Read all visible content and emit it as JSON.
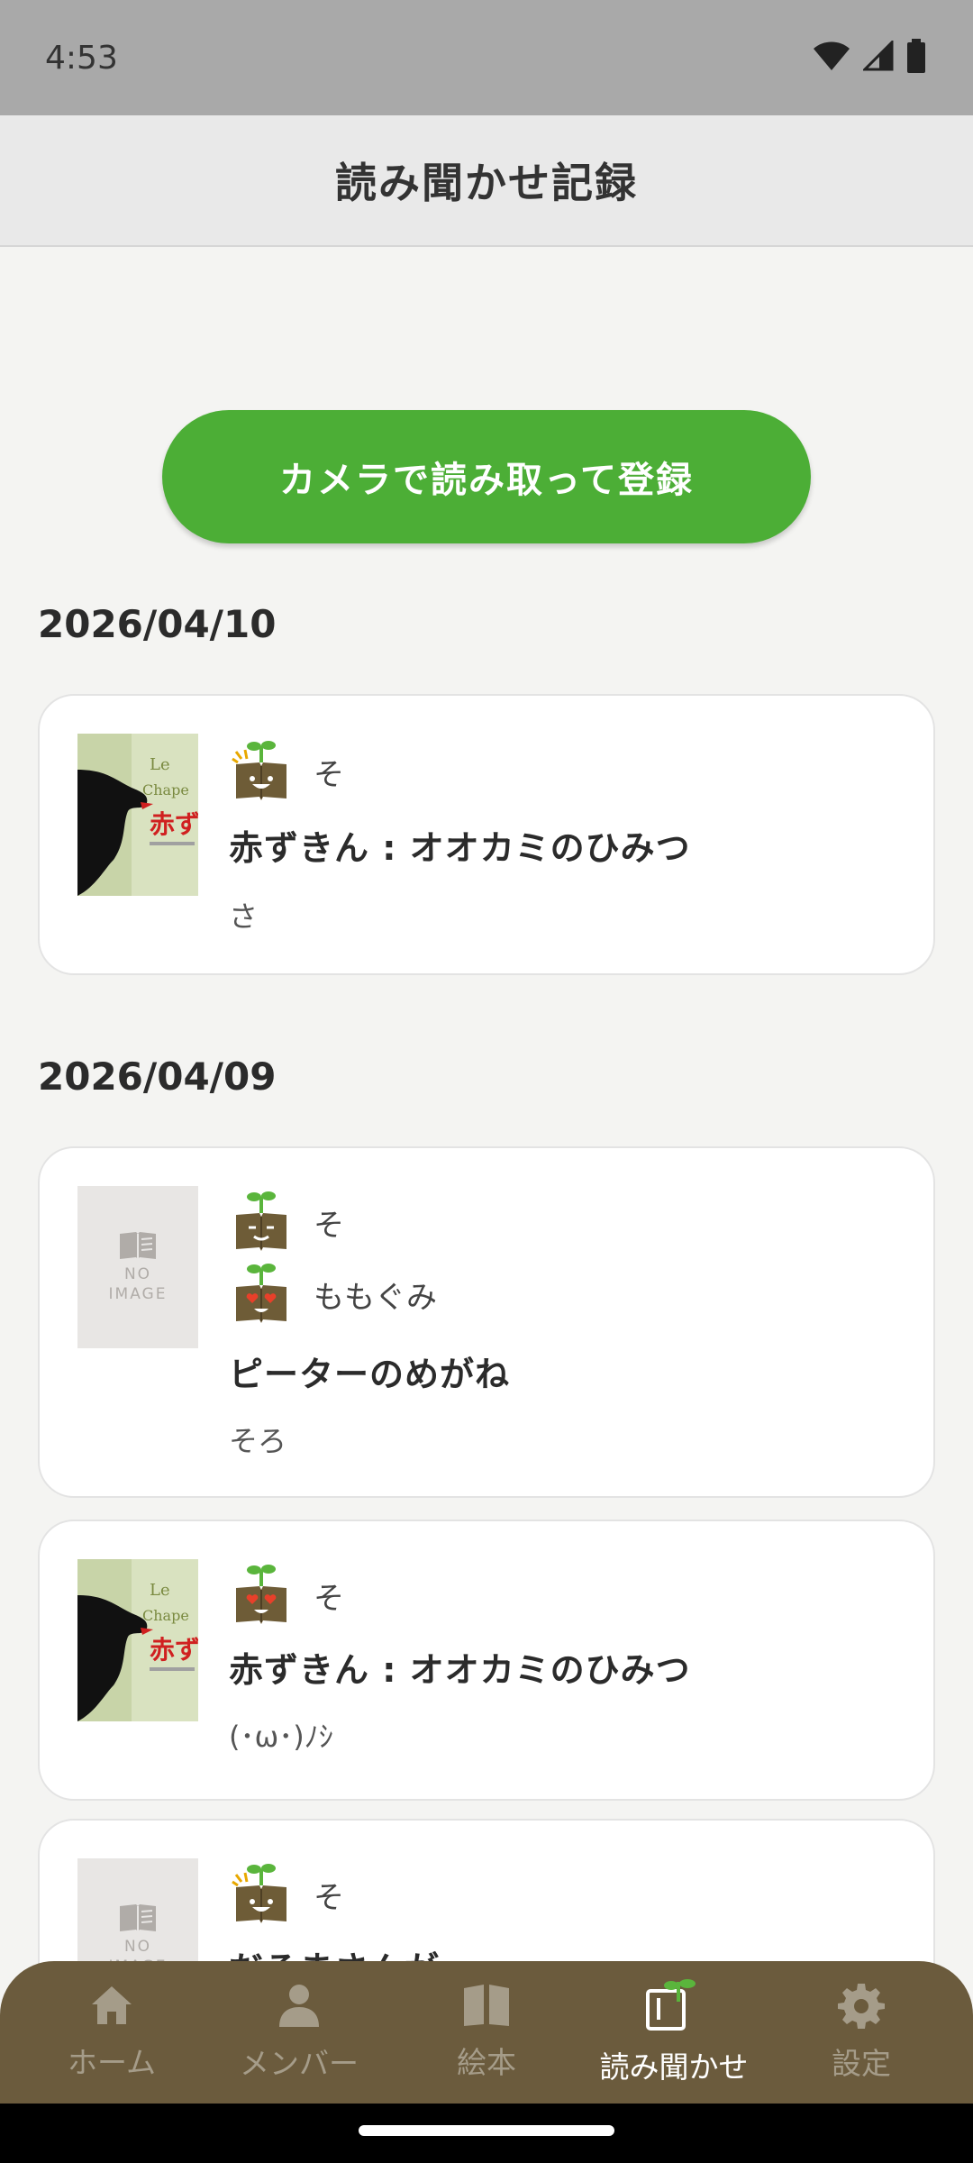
{
  "status_bar": {
    "time": "4:53",
    "icons": [
      "wifi-icon",
      "signal-icon",
      "battery-icon"
    ]
  },
  "app_bar": {
    "title": "読み聞かせ記録"
  },
  "actions": {
    "camera_button": "カメラで読み取って登録"
  },
  "groups": [
    {
      "date": "2026/04/10",
      "entries": [
        {
          "thumbnail": "book-cover",
          "members": [
            {
              "avatar": "sparkle-book-avatar",
              "name": "そ"
            }
          ],
          "title": "赤ずきん : オオカミのひみつ",
          "note": "さ"
        }
      ]
    },
    {
      "date": "2026/04/09",
      "entries": [
        {
          "thumbnail": "no-image",
          "no_image_text": [
            "NO",
            "IMAGE"
          ],
          "members": [
            {
              "avatar": "smile-book-avatar",
              "name": "そ"
            },
            {
              "avatar": "heart-eyes-book-avatar",
              "name": "ももぐみ"
            }
          ],
          "title": "ピーターのめがね",
          "note": "そろ"
        },
        {
          "thumbnail": "book-cover",
          "members": [
            {
              "avatar": "heart-eyes-book-avatar",
              "name": "そ"
            }
          ],
          "title": "赤ずきん : オオカミのひみつ",
          "note": "(･ω･)ﾉｼ"
        },
        {
          "thumbnail": "no-image",
          "no_image_text": [
            "NO",
            "IMAGE"
          ],
          "members": [
            {
              "avatar": "sparkle-book-avatar",
              "name": "そ"
            }
          ],
          "title": "だるまさんが",
          "note": ""
        }
      ]
    }
  ],
  "bottom_nav": [
    {
      "label": "ホーム",
      "icon": "home-icon",
      "active": false
    },
    {
      "label": "メンバー",
      "icon": "person-icon",
      "active": false
    },
    {
      "label": "絵本",
      "icon": "book-open-icon",
      "active": false
    },
    {
      "label": "読み聞かせ",
      "icon": "reading-sprout-icon",
      "active": true
    },
    {
      "label": "設定",
      "icon": "gear-icon",
      "active": false
    }
  ],
  "colors": {
    "accent_green": "#4cae36",
    "nav_brown": "#6b5b3d",
    "avatar_brown": "#6e5c37",
    "sprout_green": "#5ab53c",
    "background": "#f4f4f2"
  }
}
